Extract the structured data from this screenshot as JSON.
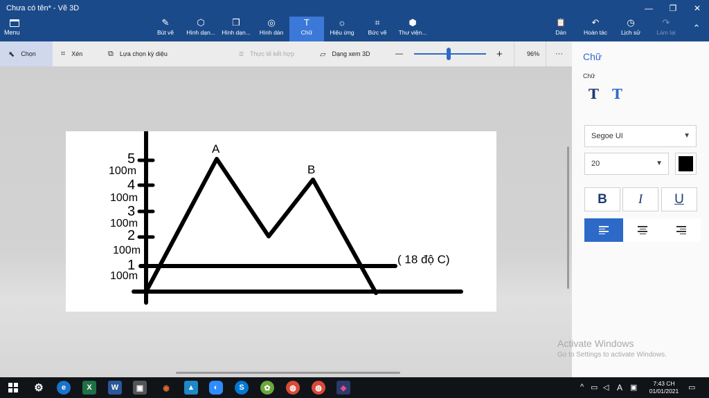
{
  "window": {
    "title": "Chưa có tên* - Vẽ 3D",
    "minimize": "—",
    "maximize": "❐",
    "close": "✕"
  },
  "ribbon": {
    "menu_label": "Menu",
    "tools": [
      {
        "label": "Bút vẽ",
        "icon": "✎"
      },
      {
        "label": "Hình dạn...",
        "icon": "⬡"
      },
      {
        "label": "Hình dạn...",
        "icon": "❒"
      },
      {
        "label": "Hình dán",
        "icon": "◎"
      },
      {
        "label": "Chữ",
        "icon": "T"
      },
      {
        "label": "Hiệu ứng",
        "icon": "☼"
      },
      {
        "label": "Bức vẽ",
        "icon": "⌗"
      },
      {
        "label": "Thư viện...",
        "icon": "⬢"
      }
    ],
    "right_tools": [
      {
        "label": "Dán",
        "icon": "📋"
      },
      {
        "label": "Hoàn tác",
        "icon": "↶"
      },
      {
        "label": "Lịch sử",
        "icon": "◷"
      },
      {
        "label": "Làm lại",
        "icon": "↷"
      }
    ],
    "collapse_icon": "⌃"
  },
  "toolbar": {
    "select_label": "Chọn",
    "crop_label": "Xén",
    "magic_select_label": "Lựa chọn kỳ diệu",
    "mixed_reality_label": "Thực tế kết hợp",
    "view3d_label": "Dạng xem 3D",
    "zoom_minus": "—",
    "zoom_plus": "+",
    "zoom_value": "96%",
    "more": "···"
  },
  "canvas": {
    "tick_labels": [
      "5",
      "4",
      "3",
      "2",
      "1"
    ],
    "interval_labels": [
      "100m",
      "100m",
      "100m",
      "100m",
      "100m"
    ],
    "peak_a": "A",
    "peak_b": "B",
    "level_note": "( 18 độ C)"
  },
  "panel": {
    "title": "Chữ",
    "section": "Chữ",
    "font_family": "Segoe UI",
    "font_size": "20",
    "text_color": "#000000",
    "bold": "B",
    "italic": "I",
    "underline": "U"
  },
  "watermark": {
    "line1": "Activate Windows",
    "line2": "Go to Settings to activate Windows."
  },
  "taskbar": {
    "apps": [
      "⚙",
      "e",
      "X",
      "W",
      "▣",
      "◉",
      "▲",
      "◐",
      "S",
      "✿",
      "◍",
      "◍",
      "◆"
    ],
    "tray_lang": "A",
    "tray_chevron": "^",
    "time": "7:43 CH",
    "date": "01/01/2021"
  }
}
